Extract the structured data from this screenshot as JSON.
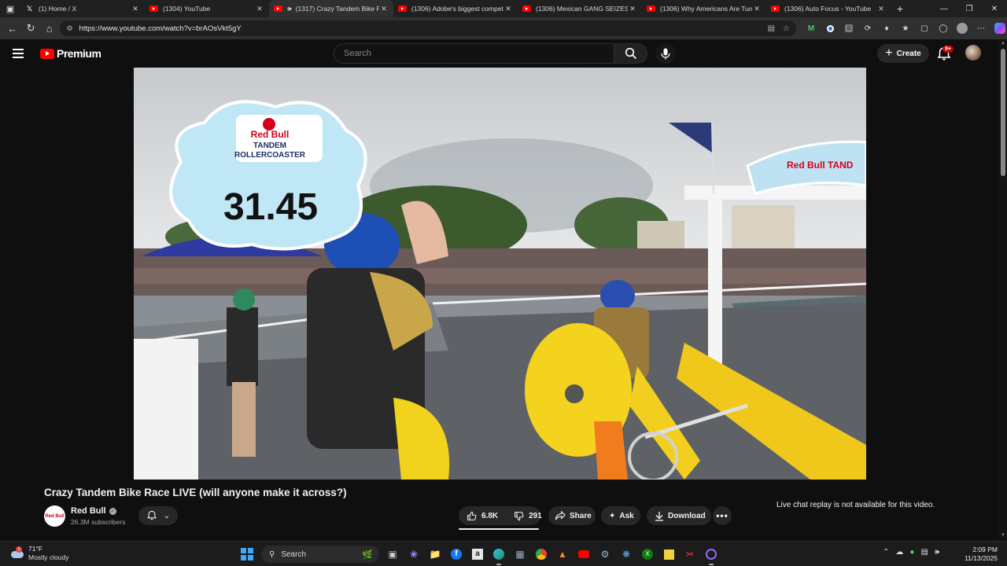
{
  "browser": {
    "tabs": [
      {
        "title": "(1) Home / X",
        "favicon": "x-icon",
        "active": false
      },
      {
        "title": "(1304) YouTube",
        "favicon": "youtube-icon",
        "active": false
      },
      {
        "title": "(1317) Crazy Tandem Bike R",
        "favicon": "youtube-icon",
        "active": true,
        "audio": true
      },
      {
        "title": "(1306) Adobe's biggest competit",
        "favicon": "youtube-icon",
        "active": false
      },
      {
        "title": "(1306) Mexican GANG SEIZES LA",
        "favicon": "youtube-icon",
        "active": false
      },
      {
        "title": "(1306) Why Americans Are Turnin",
        "favicon": "youtube-icon",
        "active": false
      },
      {
        "title": "(1306) Auto Focus - YouTube",
        "favicon": "youtube-icon",
        "active": false
      }
    ],
    "url": "https://www.youtube.com/watch?v=brAOsVkt5gY"
  },
  "youtube": {
    "logo_text": "Premium",
    "search_placeholder": "Search",
    "create_label": "Create",
    "notification_badge": "9+"
  },
  "video": {
    "overlay_brand": "Red Bull",
    "overlay_event_line1": "TANDEM",
    "overlay_event_line2": "ROLLERCOASTER",
    "overlay_time": "31.45",
    "overlay_arch_text": "Red Bull TAND",
    "progress_fraction": 0.0
  },
  "meta": {
    "title": "Crazy Tandem Bike Race LIVE (will anyone make it across?)",
    "channel_name": "Red Bull",
    "channel_avatar_text": "Red Bull",
    "subscribers": "26.3M subscribers",
    "likes": "6.8K",
    "dislikes": "291",
    "share_label": "Share",
    "ask_label": "Ask",
    "download_label": "Download",
    "chat_note": "Live chat replay is not available for this video."
  },
  "taskbar": {
    "temperature": "71°F",
    "condition": "Mostly cloudy",
    "weather_badge": "1",
    "search_label": "Search",
    "time": "2:09 PM",
    "date": "11/13/2025"
  },
  "colors": {
    "youtube_red": "#ff0000",
    "background": "#0f0f0f",
    "pill": "#272727"
  }
}
